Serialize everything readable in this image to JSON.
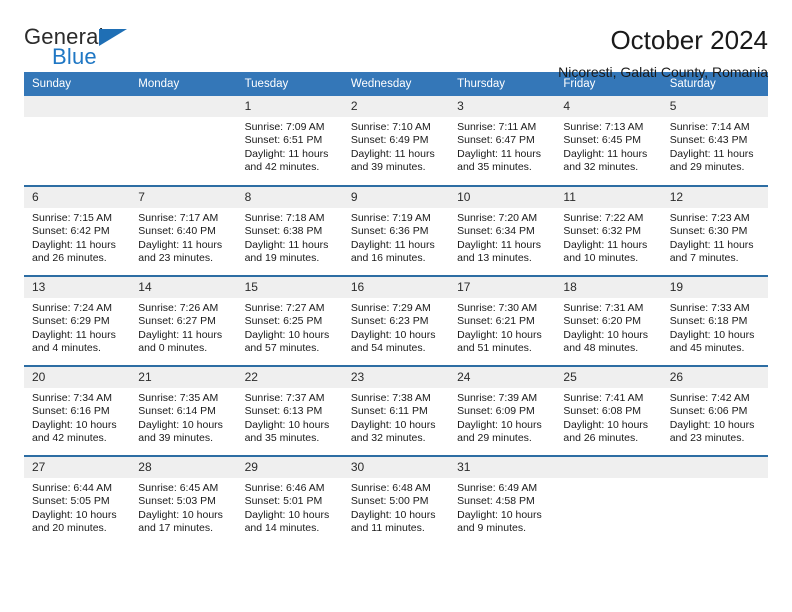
{
  "brand": {
    "name_top": "General",
    "name_bottom": "Blue",
    "accent_color": "#1f77c4"
  },
  "header": {
    "title": "October 2024",
    "subtitle": "Nicoresti, Galati County, Romania"
  },
  "calendar": {
    "header_bg": "#3477b8",
    "row_divider_color": "#2d6da3",
    "daynum_bg": "#efefef",
    "day_names": [
      "Sunday",
      "Monday",
      "Tuesday",
      "Wednesday",
      "Thursday",
      "Friday",
      "Saturday"
    ],
    "weeks": [
      [
        {
          "day": "",
          "empty": true,
          "sunrise": "",
          "sunset": "",
          "daylight_line1": "",
          "daylight_line2": ""
        },
        {
          "day": "",
          "empty": true,
          "sunrise": "",
          "sunset": "",
          "daylight_line1": "",
          "daylight_line2": ""
        },
        {
          "day": "1",
          "empty": false,
          "sunrise": "Sunrise: 7:09 AM",
          "sunset": "Sunset: 6:51 PM",
          "daylight_line1": "Daylight: 11 hours",
          "daylight_line2": "and 42 minutes."
        },
        {
          "day": "2",
          "empty": false,
          "sunrise": "Sunrise: 7:10 AM",
          "sunset": "Sunset: 6:49 PM",
          "daylight_line1": "Daylight: 11 hours",
          "daylight_line2": "and 39 minutes."
        },
        {
          "day": "3",
          "empty": false,
          "sunrise": "Sunrise: 7:11 AM",
          "sunset": "Sunset: 6:47 PM",
          "daylight_line1": "Daylight: 11 hours",
          "daylight_line2": "and 35 minutes."
        },
        {
          "day": "4",
          "empty": false,
          "sunrise": "Sunrise: 7:13 AM",
          "sunset": "Sunset: 6:45 PM",
          "daylight_line1": "Daylight: 11 hours",
          "daylight_line2": "and 32 minutes."
        },
        {
          "day": "5",
          "empty": false,
          "sunrise": "Sunrise: 7:14 AM",
          "sunset": "Sunset: 6:43 PM",
          "daylight_line1": "Daylight: 11 hours",
          "daylight_line2": "and 29 minutes."
        }
      ],
      [
        {
          "day": "6",
          "empty": false,
          "sunrise": "Sunrise: 7:15 AM",
          "sunset": "Sunset: 6:42 PM",
          "daylight_line1": "Daylight: 11 hours",
          "daylight_line2": "and 26 minutes."
        },
        {
          "day": "7",
          "empty": false,
          "sunrise": "Sunrise: 7:17 AM",
          "sunset": "Sunset: 6:40 PM",
          "daylight_line1": "Daylight: 11 hours",
          "daylight_line2": "and 23 minutes."
        },
        {
          "day": "8",
          "empty": false,
          "sunrise": "Sunrise: 7:18 AM",
          "sunset": "Sunset: 6:38 PM",
          "daylight_line1": "Daylight: 11 hours",
          "daylight_line2": "and 19 minutes."
        },
        {
          "day": "9",
          "empty": false,
          "sunrise": "Sunrise: 7:19 AM",
          "sunset": "Sunset: 6:36 PM",
          "daylight_line1": "Daylight: 11 hours",
          "daylight_line2": "and 16 minutes."
        },
        {
          "day": "10",
          "empty": false,
          "sunrise": "Sunrise: 7:20 AM",
          "sunset": "Sunset: 6:34 PM",
          "daylight_line1": "Daylight: 11 hours",
          "daylight_line2": "and 13 minutes."
        },
        {
          "day": "11",
          "empty": false,
          "sunrise": "Sunrise: 7:22 AM",
          "sunset": "Sunset: 6:32 PM",
          "daylight_line1": "Daylight: 11 hours",
          "daylight_line2": "and 10 minutes."
        },
        {
          "day": "12",
          "empty": false,
          "sunrise": "Sunrise: 7:23 AM",
          "sunset": "Sunset: 6:30 PM",
          "daylight_line1": "Daylight: 11 hours",
          "daylight_line2": "and 7 minutes."
        }
      ],
      [
        {
          "day": "13",
          "empty": false,
          "sunrise": "Sunrise: 7:24 AM",
          "sunset": "Sunset: 6:29 PM",
          "daylight_line1": "Daylight: 11 hours",
          "daylight_line2": "and 4 minutes."
        },
        {
          "day": "14",
          "empty": false,
          "sunrise": "Sunrise: 7:26 AM",
          "sunset": "Sunset: 6:27 PM",
          "daylight_line1": "Daylight: 11 hours",
          "daylight_line2": "and 0 minutes."
        },
        {
          "day": "15",
          "empty": false,
          "sunrise": "Sunrise: 7:27 AM",
          "sunset": "Sunset: 6:25 PM",
          "daylight_line1": "Daylight: 10 hours",
          "daylight_line2": "and 57 minutes."
        },
        {
          "day": "16",
          "empty": false,
          "sunrise": "Sunrise: 7:29 AM",
          "sunset": "Sunset: 6:23 PM",
          "daylight_line1": "Daylight: 10 hours",
          "daylight_line2": "and 54 minutes."
        },
        {
          "day": "17",
          "empty": false,
          "sunrise": "Sunrise: 7:30 AM",
          "sunset": "Sunset: 6:21 PM",
          "daylight_line1": "Daylight: 10 hours",
          "daylight_line2": "and 51 minutes."
        },
        {
          "day": "18",
          "empty": false,
          "sunrise": "Sunrise: 7:31 AM",
          "sunset": "Sunset: 6:20 PM",
          "daylight_line1": "Daylight: 10 hours",
          "daylight_line2": "and 48 minutes."
        },
        {
          "day": "19",
          "empty": false,
          "sunrise": "Sunrise: 7:33 AM",
          "sunset": "Sunset: 6:18 PM",
          "daylight_line1": "Daylight: 10 hours",
          "daylight_line2": "and 45 minutes."
        }
      ],
      [
        {
          "day": "20",
          "empty": false,
          "sunrise": "Sunrise: 7:34 AM",
          "sunset": "Sunset: 6:16 PM",
          "daylight_line1": "Daylight: 10 hours",
          "daylight_line2": "and 42 minutes."
        },
        {
          "day": "21",
          "empty": false,
          "sunrise": "Sunrise: 7:35 AM",
          "sunset": "Sunset: 6:14 PM",
          "daylight_line1": "Daylight: 10 hours",
          "daylight_line2": "and 39 minutes."
        },
        {
          "day": "22",
          "empty": false,
          "sunrise": "Sunrise: 7:37 AM",
          "sunset": "Sunset: 6:13 PM",
          "daylight_line1": "Daylight: 10 hours",
          "daylight_line2": "and 35 minutes."
        },
        {
          "day": "23",
          "empty": false,
          "sunrise": "Sunrise: 7:38 AM",
          "sunset": "Sunset: 6:11 PM",
          "daylight_line1": "Daylight: 10 hours",
          "daylight_line2": "and 32 minutes."
        },
        {
          "day": "24",
          "empty": false,
          "sunrise": "Sunrise: 7:39 AM",
          "sunset": "Sunset: 6:09 PM",
          "daylight_line1": "Daylight: 10 hours",
          "daylight_line2": "and 29 minutes."
        },
        {
          "day": "25",
          "empty": false,
          "sunrise": "Sunrise: 7:41 AM",
          "sunset": "Sunset: 6:08 PM",
          "daylight_line1": "Daylight: 10 hours",
          "daylight_line2": "and 26 minutes."
        },
        {
          "day": "26",
          "empty": false,
          "sunrise": "Sunrise: 7:42 AM",
          "sunset": "Sunset: 6:06 PM",
          "daylight_line1": "Daylight: 10 hours",
          "daylight_line2": "and 23 minutes."
        }
      ],
      [
        {
          "day": "27",
          "empty": false,
          "sunrise": "Sunrise: 6:44 AM",
          "sunset": "Sunset: 5:05 PM",
          "daylight_line1": "Daylight: 10 hours",
          "daylight_line2": "and 20 minutes."
        },
        {
          "day": "28",
          "empty": false,
          "sunrise": "Sunrise: 6:45 AM",
          "sunset": "Sunset: 5:03 PM",
          "daylight_line1": "Daylight: 10 hours",
          "daylight_line2": "and 17 minutes."
        },
        {
          "day": "29",
          "empty": false,
          "sunrise": "Sunrise: 6:46 AM",
          "sunset": "Sunset: 5:01 PM",
          "daylight_line1": "Daylight: 10 hours",
          "daylight_line2": "and 14 minutes."
        },
        {
          "day": "30",
          "empty": false,
          "sunrise": "Sunrise: 6:48 AM",
          "sunset": "Sunset: 5:00 PM",
          "daylight_line1": "Daylight: 10 hours",
          "daylight_line2": "and 11 minutes."
        },
        {
          "day": "31",
          "empty": false,
          "sunrise": "Sunrise: 6:49 AM",
          "sunset": "Sunset: 4:58 PM",
          "daylight_line1": "Daylight: 10 hours",
          "daylight_line2": "and 9 minutes."
        },
        {
          "day": "",
          "empty": true,
          "sunrise": "",
          "sunset": "",
          "daylight_line1": "",
          "daylight_line2": ""
        },
        {
          "day": "",
          "empty": true,
          "sunrise": "",
          "sunset": "",
          "daylight_line1": "",
          "daylight_line2": ""
        }
      ]
    ]
  }
}
